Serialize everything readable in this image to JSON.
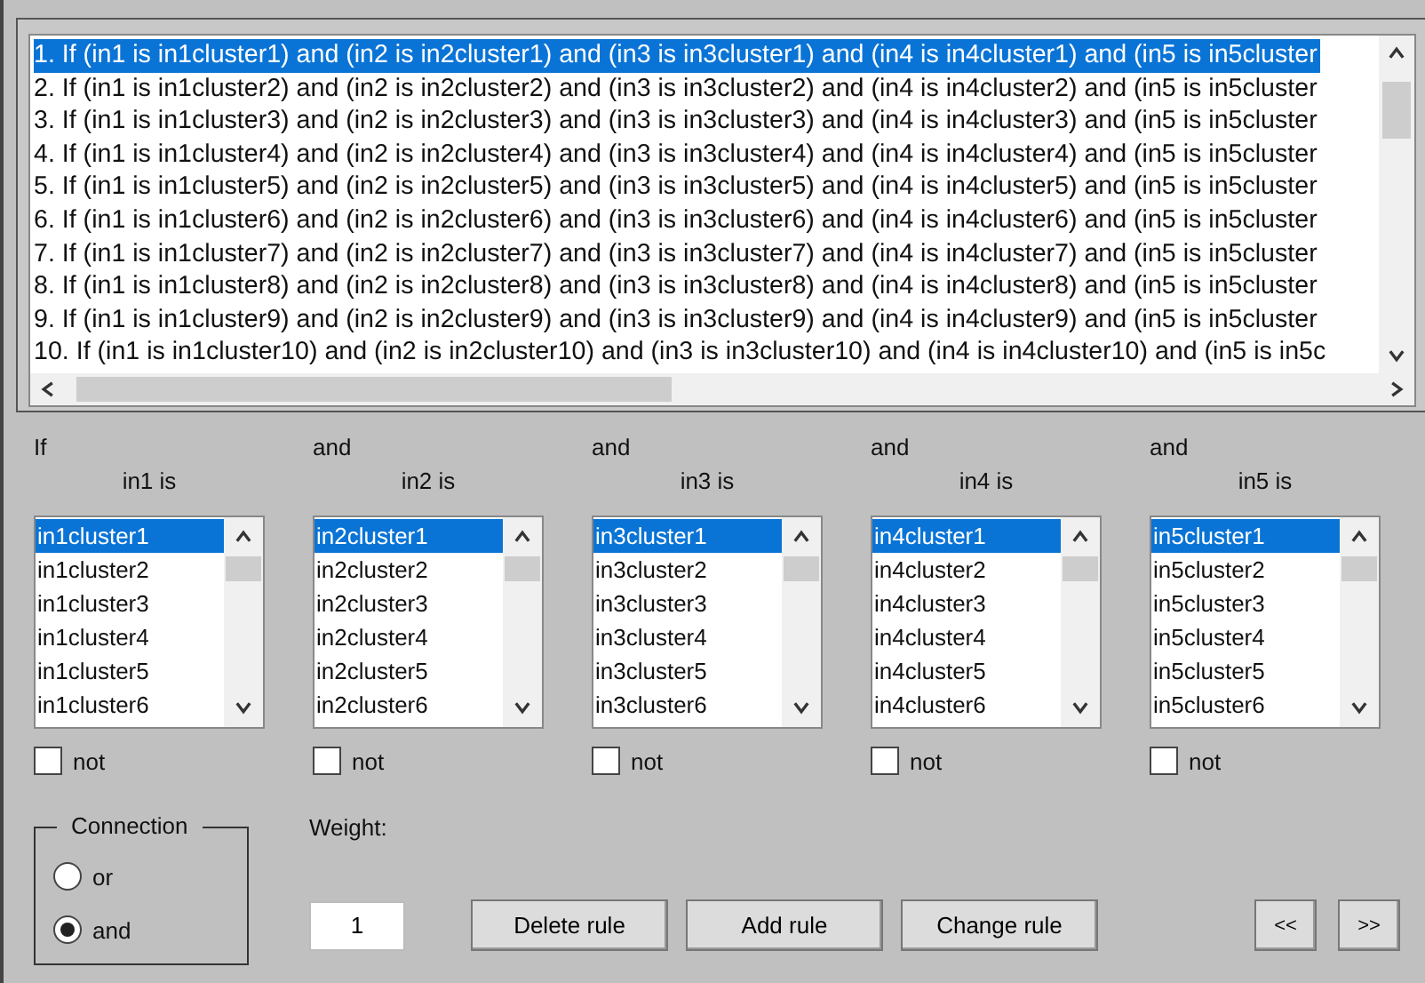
{
  "rules": [
    {
      "text": "1. If (in1 is in1cluster1) and (in2 is in2cluster1) and (in3 is in3cluster1) and (in4 is in4cluster1) and (in5 is in5cluster",
      "selected": true
    },
    {
      "text": "2. If (in1 is in1cluster2) and (in2 is in2cluster2) and (in3 is in3cluster2) and (in4 is in4cluster2) and (in5 is in5cluster",
      "selected": false
    },
    {
      "text": "3. If (in1 is in1cluster3) and (in2 is in2cluster3) and (in3 is in3cluster3) and (in4 is in4cluster3) and (in5 is in5cluster",
      "selected": false
    },
    {
      "text": "4. If (in1 is in1cluster4) and (in2 is in2cluster4) and (in3 is in3cluster4) and (in4 is in4cluster4) and (in5 is in5cluster",
      "selected": false
    },
    {
      "text": "5. If (in1 is in1cluster5) and (in2 is in2cluster5) and (in3 is in3cluster5) and (in4 is in4cluster5) and (in5 is in5cluster",
      "selected": false
    },
    {
      "text": "6. If (in1 is in1cluster6) and (in2 is in2cluster6) and (in3 is in3cluster6) and (in4 is in4cluster6) and (in5 is in5cluster",
      "selected": false
    },
    {
      "text": "7. If (in1 is in1cluster7) and (in2 is in2cluster7) and (in3 is in3cluster7) and (in4 is in4cluster7) and (in5 is in5cluster",
      "selected": false
    },
    {
      "text": "8. If (in1 is in1cluster8) and (in2 is in2cluster8) and (in3 is in3cluster8) and (in4 is in4cluster8) and (in5 is in5cluster",
      "selected": false
    },
    {
      "text": "9. If (in1 is in1cluster9) and (in2 is in2cluster9) and (in3 is in3cluster9) and (in4 is in4cluster9) and (in5 is in5cluster",
      "selected": false
    },
    {
      "text": "10. If (in1 is in1cluster10) and (in2 is in2cluster10) and (in3 is in3cluster10) and (in4 is in4cluster10) and (in5 is in5c",
      "selected": false
    }
  ],
  "antecedents": [
    {
      "connector": "If",
      "label": "in1 is",
      "options": [
        {
          "text": "in1cluster1",
          "selected": true
        },
        {
          "text": "in1cluster2",
          "selected": false
        },
        {
          "text": "in1cluster3",
          "selected": false
        },
        {
          "text": "in1cluster4",
          "selected": false
        },
        {
          "text": "in1cluster5",
          "selected": false
        },
        {
          "text": "in1cluster6",
          "selected": false
        }
      ],
      "not_label": "not",
      "not": false
    },
    {
      "connector": "and",
      "label": "in2 is",
      "options": [
        {
          "text": "in2cluster1",
          "selected": true
        },
        {
          "text": "in2cluster2",
          "selected": false
        },
        {
          "text": "in2cluster3",
          "selected": false
        },
        {
          "text": "in2cluster4",
          "selected": false
        },
        {
          "text": "in2cluster5",
          "selected": false
        },
        {
          "text": "in2cluster6",
          "selected": false
        }
      ],
      "not_label": "not",
      "not": false
    },
    {
      "connector": "and",
      "label": "in3 is",
      "options": [
        {
          "text": "in3cluster1",
          "selected": true
        },
        {
          "text": "in3cluster2",
          "selected": false
        },
        {
          "text": "in3cluster3",
          "selected": false
        },
        {
          "text": "in3cluster4",
          "selected": false
        },
        {
          "text": "in3cluster5",
          "selected": false
        },
        {
          "text": "in3cluster6",
          "selected": false
        }
      ],
      "not_label": "not",
      "not": false
    },
    {
      "connector": "and",
      "label": "in4 is",
      "options": [
        {
          "text": "in4cluster1",
          "selected": true
        },
        {
          "text": "in4cluster2",
          "selected": false
        },
        {
          "text": "in4cluster3",
          "selected": false
        },
        {
          "text": "in4cluster4",
          "selected": false
        },
        {
          "text": "in4cluster5",
          "selected": false
        },
        {
          "text": "in4cluster6",
          "selected": false
        }
      ],
      "not_label": "not",
      "not": false
    },
    {
      "connector": "and",
      "label": "in5 is",
      "options": [
        {
          "text": "in5cluster1",
          "selected": true
        },
        {
          "text": "in5cluster2",
          "selected": false
        },
        {
          "text": "in5cluster3",
          "selected": false
        },
        {
          "text": "in5cluster4",
          "selected": false
        },
        {
          "text": "in5cluster5",
          "selected": false
        },
        {
          "text": "in5cluster6",
          "selected": false
        }
      ],
      "not_label": "not",
      "not": false
    }
  ],
  "connection": {
    "label": "Connection",
    "options": [
      {
        "label": "or",
        "selected": false
      },
      {
        "label": "and",
        "selected": true
      }
    ]
  },
  "weight": {
    "label": "Weight:",
    "value": "1"
  },
  "buttons": [
    "Delete rule",
    "Add rule",
    "Change rule"
  ],
  "nav_buttons": [
    "<<",
    ">>"
  ]
}
